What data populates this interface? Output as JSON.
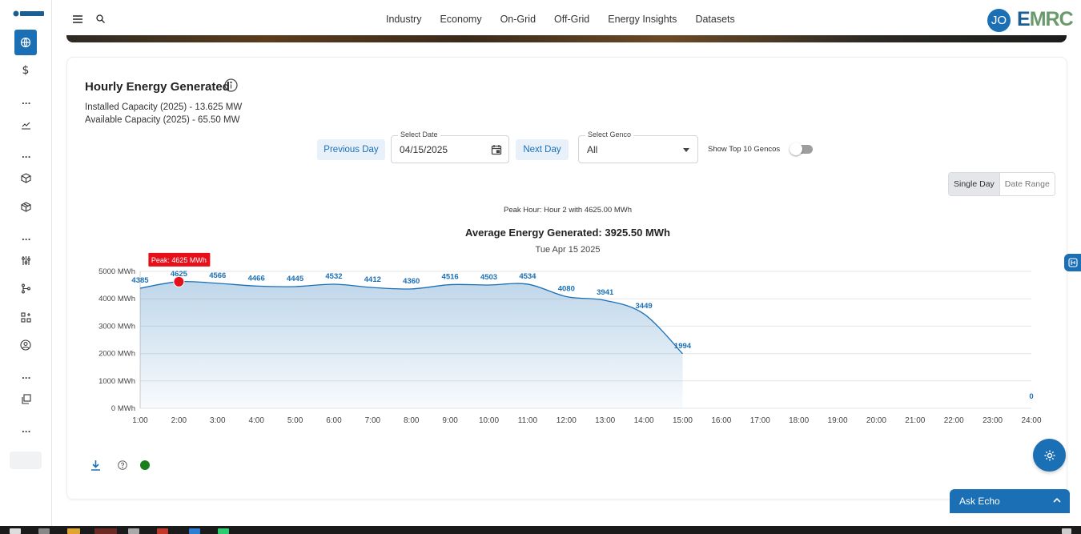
{
  "topbar": {
    "nav": [
      "Industry",
      "Economy",
      "On-Grid",
      "Off-Grid",
      "Energy Insights",
      "Datasets"
    ],
    "avatar_initials": "JO",
    "brand_first": "E",
    "brand_rest": "MRC"
  },
  "sidebar": {
    "icons": [
      "globe-icon",
      "dollar-icon",
      "trend-icon",
      "cube-icon",
      "box-icon",
      "sliders-icon",
      "git-branch-icon",
      "apps-add-icon",
      "user-circle-icon",
      "copy-icon"
    ],
    "dots": "..."
  },
  "card": {
    "title": "Hourly Energy Generated",
    "installed_capacity": "Installed Capacity (2025) - 13.625 MW",
    "available_capacity": "Available Capacity (2025) - 65.50 MW",
    "prev_day": "Previous Day",
    "next_day": "Next Day",
    "date_label": "Select Date",
    "date_value": "04/15/2025",
    "genco_label": "Select Genco",
    "genco_value": "All",
    "toggle_label": "Show Top 10 Gencos",
    "toggle_on": false,
    "view_single": "Single Day",
    "view_range": "Date Range",
    "peak_hour_text": "Peak Hour: Hour 2 with 4625.00 MWh",
    "avg_text": "Average Energy Generated: 3925.50 MWh",
    "date_sub": "Tue Apr 15 2025",
    "status_color": "#1a7f1a"
  },
  "chart_data": {
    "type": "area",
    "x": [
      "1:00",
      "2:00",
      "3:00",
      "4:00",
      "5:00",
      "6:00",
      "7:00",
      "8:00",
      "9:00",
      "10:00",
      "11:00",
      "12:00",
      "13:00",
      "14:00",
      "15:00",
      "16:00",
      "17:00",
      "18:00",
      "19:00",
      "20:00",
      "21:00",
      "22:00",
      "23:00",
      "24:00"
    ],
    "series": [
      {
        "values": [
          4385,
          4625,
          4566,
          4466,
          4445,
          4532,
          4412,
          4360,
          4516,
          4503,
          4534,
          4080,
          3941,
          3449,
          1994,
          null,
          null,
          null,
          null,
          null,
          null,
          null,
          null,
          0
        ]
      }
    ],
    "y_ticks": [
      "0 MWh",
      "1000 MWh",
      "2000 MWh",
      "3000 MWh",
      "4000 MWh",
      "5000 MWh"
    ],
    "ylim": [
      0,
      5000
    ],
    "peak_label": "Peak: 4625 MWh",
    "peak_index": 1,
    "color": "#1b6fb5",
    "grid": true
  },
  "widgets": {
    "ask_echo": "Ask Echo"
  }
}
